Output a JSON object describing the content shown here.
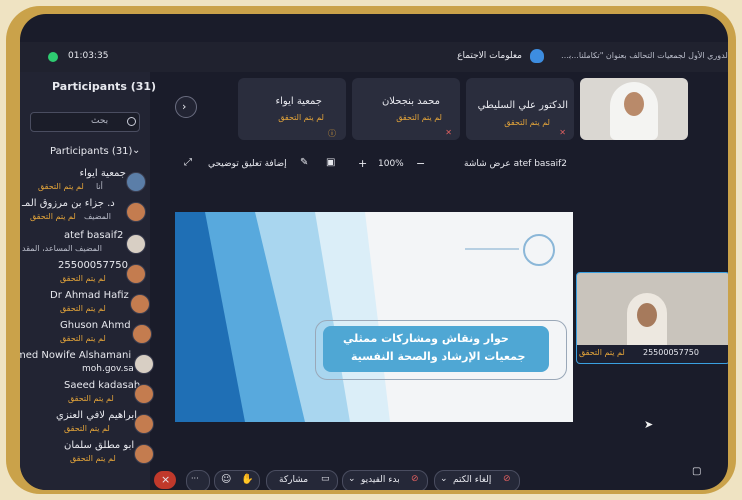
{
  "top_bar": {
    "timer": "01:03:35",
    "meeting_info": "معلومات الاجتماع",
    "meeting_title": "الدوري الأول لجمعيات التحالف بعنوان \"تكاملنا...بنـ..."
  },
  "sidebar": {
    "title": "Participants (31)",
    "search_placeholder": "بحث",
    "section_label": "Participants (31)",
    "participants": [
      {
        "name": "جمعية ايواء",
        "role": "أنا",
        "status": "لم يتم التحقق"
      },
      {
        "name": "د. جزاء بن مرزوق المـ",
        "role": "المضيف",
        "status": "لم يتم التحقق"
      },
      {
        "name": "atef basaif2",
        "role": "المضيف المساعد، المقد",
        "status": ""
      },
      {
        "name": "25500057750",
        "role": "",
        "status": "لم يتم التحقق"
      },
      {
        "name": "Dr Ahmad Hafiz",
        "role": "",
        "status": "لم يتم التحقق"
      },
      {
        "name": "Ghuson Ahmd",
        "role": "",
        "status": "لم يتم التحقق"
      },
      {
        "name": "med Nowife Alshamani",
        "role": "moh.gov.sa",
        "status": ""
      },
      {
        "name": "Saeed kadasah",
        "role": "",
        "status": "لم يتم التحقق"
      },
      {
        "name": "ابراهيم لافي العنزي",
        "role": "",
        "status": "لم يتم التحقق"
      },
      {
        "name": "ابو مطلق سلمان",
        "role": "",
        "status": "لم يتم التحقق"
      }
    ]
  },
  "video_cards": [
    {
      "name": "جمعية ايواء",
      "status": "لم يتم التحقق"
    },
    {
      "name": "محمد بنجحلان",
      "status": "لم يتم التحقق"
    },
    {
      "name": "الدكتور علي السليطي",
      "status": "لم يتم التحقق"
    }
  ],
  "share_toolbar": {
    "annotate": "إضافة تعليق توضيحي",
    "zoom": "100%",
    "plus": "+",
    "minus": "−",
    "screen_label": "عرض شاشة atef basaif2"
  },
  "slide": {
    "line1": "حوار ونقاش ومشاركات ممثلي",
    "line2": "جمعيات الإرشاد والصحة النفسية"
  },
  "side_video": {
    "name": "25500057750",
    "status": "لم يتم التحقق"
  },
  "bottom_bar": {
    "mute": "إلغاء الكتم",
    "video": "بدء الفيديو",
    "share": "مشاركة",
    "more": "···",
    "close": "×"
  },
  "colors": {
    "accent": "#e3a43a",
    "frame": "#caa24a",
    "background": "#1a1c2a",
    "slide_box": "#4fa7d4"
  }
}
